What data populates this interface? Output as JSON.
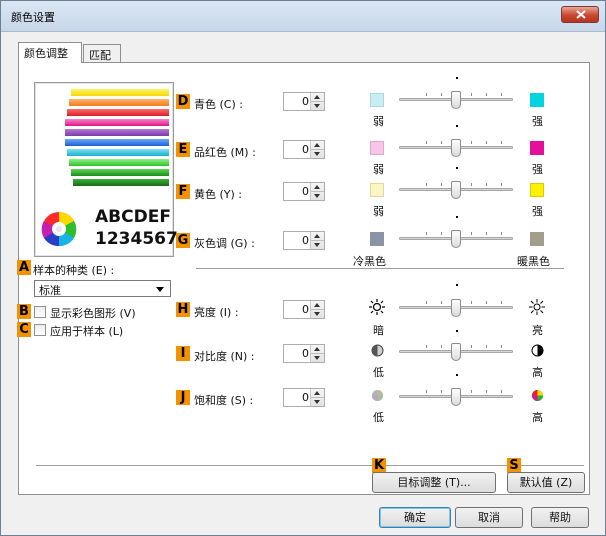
{
  "window": {
    "title": "颜色设置",
    "close_icon": "close-icon"
  },
  "tabs": [
    {
      "label": "颜色调整"
    },
    {
      "label": "匹配"
    }
  ],
  "preview": {
    "text1": "ABCDEF",
    "text2": "1234567"
  },
  "sliders": [
    {
      "letter": "D",
      "label": "青色 (C) :",
      "value": "0",
      "left": "弱",
      "right": "强",
      "low_color": "#c7eef5",
      "high_color": "#00d4e0"
    },
    {
      "letter": "E",
      "label": "品红色 (M) :",
      "value": "0",
      "left": "弱",
      "right": "强",
      "low_color": "#f7c5e6",
      "high_color": "#e4109a"
    },
    {
      "letter": "F",
      "label": "黄色 (Y) :",
      "value": "0",
      "left": "弱",
      "right": "强",
      "low_color": "#fbf5c4",
      "high_color": "#fff200"
    },
    {
      "letter": "G",
      "label": "灰色调 (G) :",
      "value": "0",
      "left": "冷黑色",
      "right": "暖黑色",
      "low_color": "#8b94a6",
      "high_color": "#a39e8a"
    },
    {
      "letter": "H",
      "label": "亮度 (I) :",
      "value": "0",
      "left": "暗",
      "right": "亮",
      "icon_left": "dim-sun-icon",
      "icon_right": "bright-sun-icon"
    },
    {
      "letter": "I",
      "label": "对比度 (N) :",
      "value": "0",
      "left": "低",
      "right": "高",
      "icon_left": "contrast-low-icon",
      "icon_right": "contrast-high-icon"
    },
    {
      "letter": "J",
      "label": "饱和度 (S) :",
      "value": "0",
      "left": "低",
      "right": "高",
      "icon_left": "saturation-low-icon",
      "icon_right": "saturation-high-icon"
    }
  ],
  "sample": {
    "letter": "A",
    "label": "样本的种类 (E) :",
    "selected": "标准",
    "b_letter": "B",
    "b_label": "显示彩色图形 (V)",
    "c_letter": "C",
    "c_label": "应用于样本 (L)"
  },
  "buttons": {
    "k_letter": "K",
    "target_adjust": "目标调整 (T)...",
    "s_letter": "S",
    "defaults": "默认值 (Z)",
    "ok": "确定",
    "cancel": "取消",
    "help": "帮助"
  }
}
